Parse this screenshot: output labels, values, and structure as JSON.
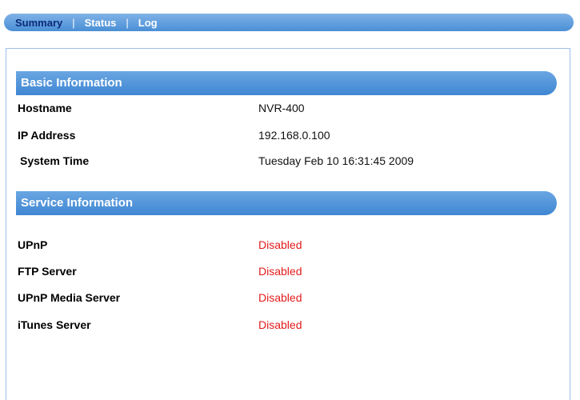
{
  "tabs": [
    {
      "label": "Summary"
    },
    {
      "label": "Status"
    },
    {
      "label": "Log"
    }
  ],
  "tab_separator": "|",
  "basic_information": {
    "title": "Basic Information",
    "rows": [
      {
        "label": "Hostname",
        "value": "NVR-400"
      },
      {
        "label": "IP Address",
        "value": "192.168.0.100"
      },
      {
        "label": "System Time",
        "value": "Tuesday Feb 10 16:31:45 2009"
      }
    ]
  },
  "service_information": {
    "title": "Service Information",
    "rows": [
      {
        "label": "UPnP",
        "value": "Disabled"
      },
      {
        "label": "FTP Server",
        "value": "Disabled"
      },
      {
        "label": "UPnP Media Server",
        "value": "Disabled"
      },
      {
        "label": "iTunes Server",
        "value": "Disabled"
      }
    ]
  },
  "colors": {
    "active_tab": "#0b2a78",
    "header_bar": "#4a8fd6",
    "status_disabled": "#e21b1b"
  }
}
